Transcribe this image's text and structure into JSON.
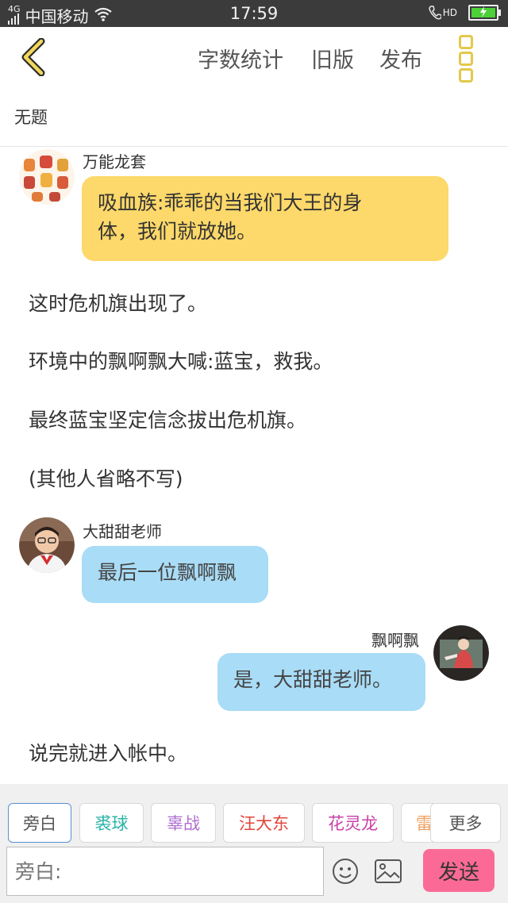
{
  "status_bar": {
    "network": "4G",
    "carrier": "中国移动",
    "time": "17:59",
    "hd": "HD"
  },
  "nav": {
    "word_count": "字数统计",
    "old_version": "旧版",
    "publish": "发布"
  },
  "document": {
    "title": "无题"
  },
  "messages": [
    {
      "type": "left",
      "user": "万能龙套",
      "text_lines": [
        "吸血族:乖乖的当我们大王的身",
        "体，我们就放她。"
      ]
    },
    {
      "type": "narration",
      "text": "这时危机旗出现了。"
    },
    {
      "type": "narration",
      "text": "环境中的飘啊飘大喊:蓝宝，救我。"
    },
    {
      "type": "narration",
      "text": "最终蓝宝坚定信念拔出危机旗。"
    },
    {
      "type": "narration",
      "text": "(其他人省略不写)"
    },
    {
      "type": "left",
      "user": "大甜甜老师",
      "text": "最后一位飘啊飘"
    },
    {
      "type": "right",
      "user": "飘啊飘",
      "text": "是，大甜甜老师。"
    },
    {
      "type": "narration",
      "text": "说完就进入帐中。"
    }
  ],
  "roles": [
    {
      "label": "旁白",
      "color": "#555555"
    },
    {
      "label": "裘球",
      "color": "#2bb3a8"
    },
    {
      "label": "辜战",
      "color": "#b06fd0"
    },
    {
      "label": "汪大东",
      "color": "#e0453a"
    },
    {
      "label": "花灵龙",
      "color": "#c840a8"
    },
    {
      "label": "雷",
      "color": "#f0a060"
    }
  ],
  "more_label": "更多",
  "input": {
    "placeholder": "旁白:"
  },
  "send_label": "发送"
}
